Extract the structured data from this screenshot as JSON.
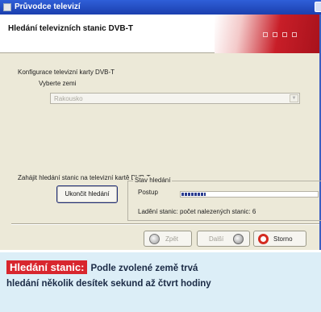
{
  "window": {
    "title": "Průvodce televizí",
    "header_title": "Hledání televizních stanic DVB-T"
  },
  "config": {
    "section_label": "Konfigurace televizní karty DVB-T",
    "country_label": "Vyberte zemi",
    "country_value": "Rakousko"
  },
  "search": {
    "start_label": "Zahájit hledání stanic na televizní kartě DVB-T",
    "stop_button": "Ukončit hledání",
    "status_group_title": "Stav hledání",
    "progress_label": "Postup",
    "progress_fraction": 0.18,
    "found_label": "Ladění stanic: počet nalezených stanic: 6"
  },
  "nav": {
    "back": "Zpět",
    "next": "Další",
    "close": "Storno"
  },
  "caption": {
    "badge": "Hledání stanic:",
    "line1": "Podle zvolené země trvá",
    "line2": "hledání několik desítek sekund až čtvrt hodiny"
  },
  "colors": {
    "title_bar": "#1b3fae",
    "accent_red": "#d8262e",
    "caption_bg": "#dceef7"
  }
}
